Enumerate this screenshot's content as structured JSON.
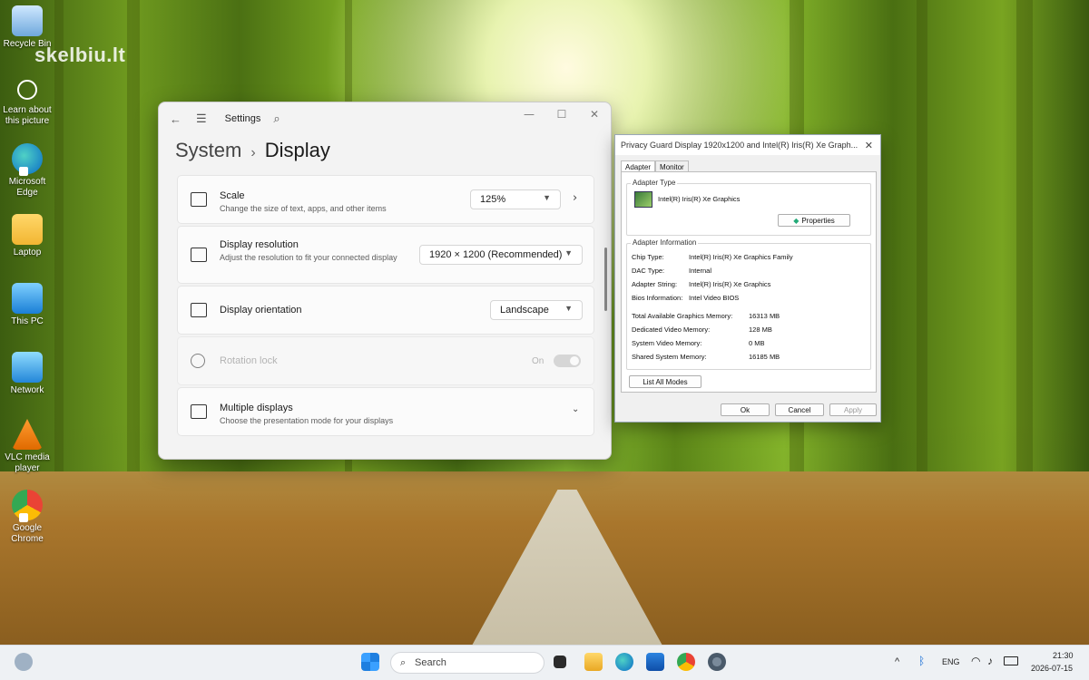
{
  "desktop": {
    "watermark": "skelbiu.lt",
    "icons": [
      {
        "label": "Recycle Bin",
        "icon": "recycle-bin-icon"
      },
      {
        "label": "Learn about this picture",
        "icon": "learn-picture-icon"
      },
      {
        "label": "Microsoft Edge",
        "icon": "edge-icon"
      },
      {
        "label": "Laptop",
        "icon": "folder-user-icon"
      },
      {
        "label": "This PC",
        "icon": "monitor-icon"
      },
      {
        "label": "Network",
        "icon": "network-icon"
      },
      {
        "label": "VLC media player",
        "icon": "vlc-cone-icon"
      },
      {
        "label": "Google Chrome",
        "icon": "chrome-icon"
      }
    ]
  },
  "settings": {
    "title": "Settings",
    "breadcrumb_parent": "System",
    "breadcrumb_current": "Display",
    "scale": {
      "label": "Scale",
      "desc": "Change the size of text, apps, and other items",
      "value": "125%"
    },
    "resolution": {
      "label": "Display resolution",
      "desc": "Adjust the resolution to fit your connected display",
      "value": "1920 × 1200 (Recommended)"
    },
    "orientation": {
      "label": "Display orientation",
      "value": "Landscape"
    },
    "rotation": {
      "label": "Rotation lock",
      "state": "On"
    },
    "multiple": {
      "label": "Multiple displays",
      "desc": "Choose the presentation mode for your displays"
    }
  },
  "adapter_dialog": {
    "title": "Privacy Guard Display 1920x1200 and Intel(R) Iris(R) Xe Graph...",
    "tabs": [
      "Adapter",
      "Monitor"
    ],
    "adapter_type_label": "Adapter Type",
    "adapter_name": "Intel(R) Iris(R) Xe Graphics",
    "properties_button": "Properties",
    "info_label": "Adapter Information",
    "info": [
      {
        "k": "Chip Type:",
        "v": "Intel(R) Iris(R) Xe Graphics Family"
      },
      {
        "k": "DAC Type:",
        "v": "Internal"
      },
      {
        "k": "Adapter String:",
        "v": "Intel(R) Iris(R) Xe Graphics"
      },
      {
        "k": "Bios Information:",
        "v": "Intel Video BIOS"
      }
    ],
    "memory": [
      {
        "k": "Total Available Graphics Memory:",
        "v": "16313 MB"
      },
      {
        "k": "Dedicated Video Memory:",
        "v": "128 MB"
      },
      {
        "k": "System Video Memory:",
        "v": "0 MB"
      },
      {
        "k": "Shared System Memory:",
        "v": "16185 MB"
      }
    ],
    "list_modes_button": "List All Modes",
    "ok": "Ok",
    "cancel": "Cancel",
    "apply": "Apply"
  },
  "taskbar": {
    "search_placeholder": "Search",
    "language": "ENG",
    "time": "21:30",
    "date": "2026-07-15"
  },
  "colors": {
    "accent": "#0067c0",
    "taskbar": "#eef1f4"
  }
}
